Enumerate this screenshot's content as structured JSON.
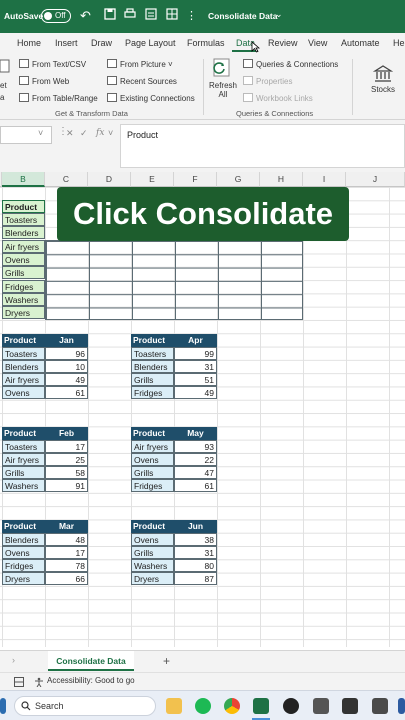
{
  "titlebar": {
    "autosave_label": "AutoSave",
    "toggle_state": "Off",
    "doc_title": "Consolidate Data",
    "doc_chevron": "⌄"
  },
  "tabs": [
    "Home",
    "Insert",
    "Draw",
    "Page Layout",
    "Formulas",
    "Data",
    "Review",
    "View",
    "Automate",
    "Hel"
  ],
  "active_tab": "Data",
  "ribbon": {
    "left_cut_1": "et",
    "left_cut_2": "a",
    "from_text_csv": "From Text/CSV",
    "from_web": "From Web",
    "from_table_range": "From Table/Range",
    "from_picture": "From Picture",
    "recent_sources": "Recent Sources",
    "existing_connections": "Existing Connections",
    "get_transform_label": "Get & Transform Data",
    "refresh_all_1": "Refresh",
    "refresh_all_2": "All",
    "queries_connections": "Queries & Connections",
    "properties": "Properties",
    "workbook_links": "Workbook Links",
    "queries_group_label": "Queries & Connections",
    "stocks": "Stocks"
  },
  "formula_bar": {
    "fx": "fx",
    "content": "Product"
  },
  "columns": [
    "B",
    "C",
    "D",
    "E",
    "F",
    "G",
    "H",
    "I",
    "J"
  ],
  "selected_column": "B",
  "consolidate_list": {
    "header": "Product",
    "items": [
      "Toasters",
      "Blenders",
      "Air fryers",
      "Ovens",
      "Grills",
      "Fridges",
      "Washers",
      "Dryers"
    ]
  },
  "caption": "Click Consolidate",
  "tables": [
    {
      "header": [
        "Product",
        "Jan"
      ],
      "rows": [
        [
          "Toasters",
          "96"
        ],
        [
          "Blenders",
          "10"
        ],
        [
          "Air fryers",
          "49"
        ],
        [
          "Ovens",
          "61"
        ]
      ]
    },
    {
      "header": [
        "Product",
        "Apr"
      ],
      "rows": [
        [
          "Toasters",
          "99"
        ],
        [
          "Blenders",
          "31"
        ],
        [
          "Grills",
          "51"
        ],
        [
          "Fridges",
          "49"
        ]
      ]
    },
    {
      "header": [
        "Product",
        "Feb"
      ],
      "rows": [
        [
          "Toasters",
          "17"
        ],
        [
          "Air fryers",
          "25"
        ],
        [
          "Grills",
          "58"
        ],
        [
          "Washers",
          "91"
        ]
      ]
    },
    {
      "header": [
        "Product",
        "May"
      ],
      "rows": [
        [
          "Air fryers",
          "93"
        ],
        [
          "Ovens",
          "22"
        ],
        [
          "Grills",
          "47"
        ],
        [
          "Fridges",
          "61"
        ]
      ]
    },
    {
      "header": [
        "Product",
        "Mar"
      ],
      "rows": [
        [
          "Blenders",
          "48"
        ],
        [
          "Ovens",
          "17"
        ],
        [
          "Fridges",
          "78"
        ],
        [
          "Dryers",
          "66"
        ]
      ]
    },
    {
      "header": [
        "Product",
        "Jun"
      ],
      "rows": [
        [
          "Ovens",
          "38"
        ],
        [
          "Grills",
          "31"
        ],
        [
          "Washers",
          "80"
        ],
        [
          "Dryers",
          "87"
        ]
      ]
    }
  ],
  "sheet_tab": "Consolidate Data",
  "status": {
    "accessibility": "Accessibility: Good to go"
  },
  "taskbar": {
    "search_placeholder": "Search"
  },
  "colors": {
    "excel_green": "#1e7145",
    "table_header": "#1f4e6a",
    "label_fill": "#dbeef7",
    "consolidate_fill": "#d9f2d0",
    "caption_bg": "#1d5d2d"
  }
}
